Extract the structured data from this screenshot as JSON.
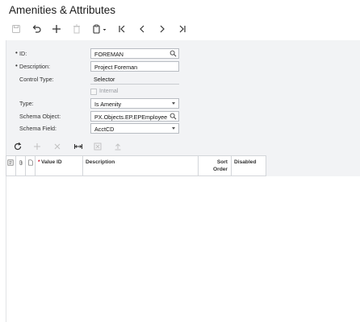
{
  "title": "Amenities & Attributes",
  "toolbar": {
    "icons": [
      "save-icon",
      "undo-icon",
      "add-icon",
      "delete-icon",
      "copy-paste-icon",
      "first-record-icon",
      "previous-record-icon",
      "next-record-icon",
      "last-record-icon"
    ]
  },
  "form": {
    "id": {
      "label": "ID:",
      "value": "FOREMAN",
      "required": "•"
    },
    "description": {
      "label": "Description:",
      "value": "Project Foreman",
      "required": "•"
    },
    "control_type": {
      "label": "Control Type:",
      "value": "Selector"
    },
    "internal": {
      "label": "Internal",
      "checked": false
    },
    "type": {
      "label": "Type:",
      "value": "Is Amenity"
    },
    "schema_object": {
      "label": "Schema Object:",
      "value": "PX.Objects.EP.EPEmployee"
    },
    "schema_field": {
      "label": "Schema Field:",
      "value": "AcctCD"
    }
  },
  "grid": {
    "toolbar_icons": [
      "refresh-icon",
      "add-row-icon",
      "delete-row-icon",
      "fit-columns-icon",
      "export-excel-icon",
      "upload-icon"
    ],
    "columns": {
      "value_id": "Value ID",
      "value_id_required": "*",
      "description": "Description",
      "sort_order_1": "Sort",
      "sort_order_2": "Order",
      "disabled": "Disabled"
    },
    "rows": []
  },
  "colors": {
    "panel_bg": "#f2f3f5",
    "border": "#b8bcc2",
    "required_star": "#d0021b"
  }
}
